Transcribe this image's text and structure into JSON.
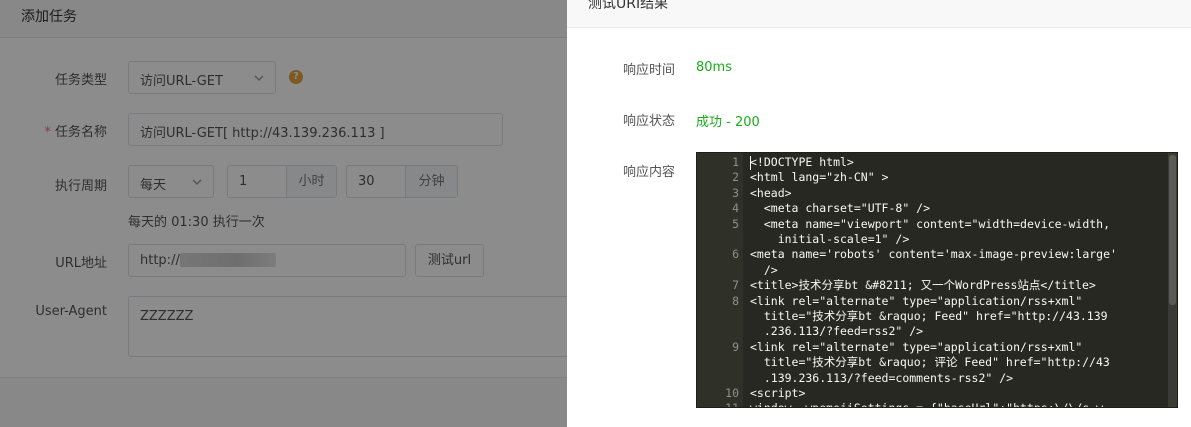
{
  "left_panel": {
    "title": "添加任务",
    "task_type": {
      "label": "任务类型",
      "value": "访问URL-GET",
      "help_icon": "?"
    },
    "task_name": {
      "required_mark": "*",
      "label": "任务名称",
      "value": "访问URL-GET[ http://43.139.236.113 ]"
    },
    "period": {
      "label": "执行周期",
      "frequency": "每天",
      "hour_value": "1",
      "hour_unit": "小时",
      "minute_value": "30",
      "minute_unit": "分钟",
      "hint": "每天的 01:30 执行一次"
    },
    "url": {
      "label": "URL地址",
      "value": "http://",
      "test_button": "测试url"
    },
    "user_agent": {
      "label": "User-Agent",
      "value": "ZZZZZZ"
    }
  },
  "drawer": {
    "title": "测试URI结果",
    "response_time": {
      "label": "响应时间",
      "value": "80ms"
    },
    "response_status": {
      "label": "响应状态",
      "value": "成功 - 200"
    },
    "response_content": {
      "label": "响应内容",
      "lines": [
        {
          "no": "1",
          "text": "<!DOCTYPE html>"
        },
        {
          "no": "2",
          "text": "<html lang=\"zh-CN\" >"
        },
        {
          "no": "3",
          "text": "<head>"
        },
        {
          "no": "4",
          "text": "  <meta charset=\"UTF-8\" />"
        },
        {
          "no": "5",
          "text": "  <meta name=\"viewport\" content=\"width=device-width,"
        },
        {
          "no": "",
          "text": "    initial-scale=1\" />"
        },
        {
          "no": "6",
          "text": "<meta name='robots' content='max-image-preview:large'"
        },
        {
          "no": "",
          "text": "  />"
        },
        {
          "no": "7",
          "text": "<title>技术分享bt &#8211; 又一个WordPress站点</title>"
        },
        {
          "no": "8",
          "text": "<link rel=\"alternate\" type=\"application/rss+xml\""
        },
        {
          "no": "",
          "text": "  title=\"技术分享bt &raquo; Feed\" href=\"http://43.139"
        },
        {
          "no": "",
          "text": "  .236.113/?feed=rss2\" />"
        },
        {
          "no": "9",
          "text": "<link rel=\"alternate\" type=\"application/rss+xml\""
        },
        {
          "no": "",
          "text": "  title=\"技术分享bt &raquo; 评论 Feed\" href=\"http://43"
        },
        {
          "no": "",
          "text": "  .139.236.113/?feed=comments-rss2\" />"
        },
        {
          "no": "10",
          "text": "<script>"
        },
        {
          "no": "11",
          "text": "window._wpemojiSettings = {\"baseUrl\":\"https:\\/\\/s.w"
        }
      ]
    }
  }
}
